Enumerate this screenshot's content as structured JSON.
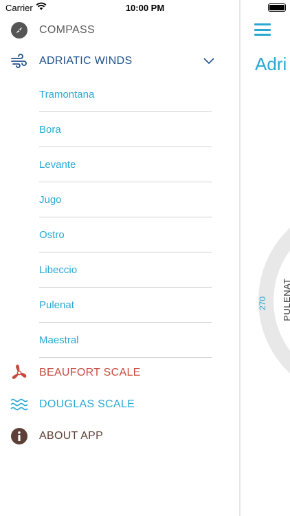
{
  "status_bar": {
    "carrier": "Carrier",
    "time": "10:00 PM"
  },
  "menu": {
    "compass": {
      "label": "COMPASS",
      "color": "#5b5b5b"
    },
    "adriatic_winds": {
      "label": "ADRIATIC WINDS",
      "color": "#1f4f8a",
      "expanded": true
    },
    "winds": [
      "Tramontana",
      "Bora",
      "Levante",
      "Jugo",
      "Ostro",
      "Libeccio",
      "Pulenat",
      "Maestral"
    ],
    "beaufort": {
      "label": "BEAUFORT SCALE",
      "color": "#c84a3f"
    },
    "douglas": {
      "label": "DOUGLAS SCALE",
      "color": "#29a8d3"
    },
    "about": {
      "label": "ABOUT APP",
      "color": "#5d4037"
    }
  },
  "main": {
    "title": "Adri",
    "dial_label_degree": "270",
    "dial_label_wind": "PULENAT"
  },
  "colors": {
    "accent": "#29a8d3"
  }
}
